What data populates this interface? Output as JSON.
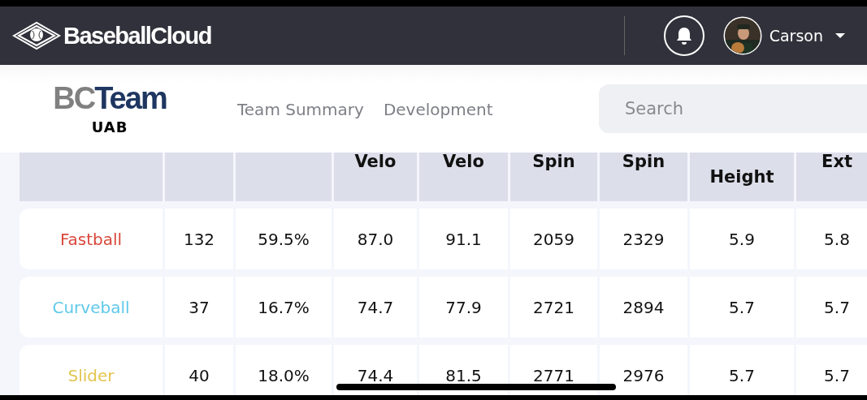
{
  "topbar": {
    "brand": "BaseballCloud",
    "user": {
      "name": "Carson"
    }
  },
  "subheader": {
    "team_logo": {
      "initials": "BC",
      "word": "Team"
    },
    "team": "UAB",
    "nav": [
      "Team Summary",
      "Development"
    ],
    "search": {
      "placeholder": "Search"
    }
  },
  "table": {
    "columns": [
      "",
      "",
      "",
      "Velo",
      "Velo",
      "Spin",
      "Spin",
      "Height",
      "Ext"
    ],
    "rows": [
      {
        "color": "#d9483b",
        "cells": [
          "Fastball",
          "132",
          "59.5%",
          "87.0",
          "91.1",
          "2059",
          "2329",
          "5.9",
          "5.8"
        ]
      },
      {
        "color": "#5ec9e9",
        "cells": [
          "Curveball",
          "37",
          "16.7%",
          "74.7",
          "77.9",
          "2721",
          "2894",
          "5.7",
          "5.7"
        ]
      },
      {
        "color": "#e2c550",
        "cells": [
          "Slider",
          "40",
          "18.0%",
          "74.4",
          "81.5",
          "2771",
          "2976",
          "5.7",
          "5.7"
        ]
      }
    ]
  }
}
